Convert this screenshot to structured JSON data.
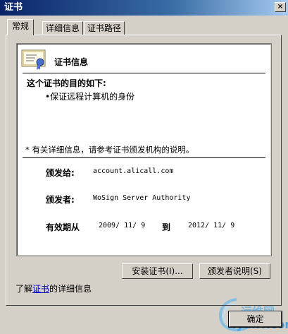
{
  "window": {
    "title": "证书",
    "close_label": "×"
  },
  "tabs": [
    {
      "label": "常规",
      "active": true
    },
    {
      "label": "详细信息",
      "active": false
    },
    {
      "label": "证书路径",
      "active": false
    }
  ],
  "cert": {
    "header": "证书信息",
    "purpose_heading": "这个证书的目的如下:",
    "purpose_items": [
      "•保证远程计算机的身份"
    ],
    "note": "* 有关详细信息，请参考证书颁发机构的说明。",
    "issued_to_label": "颁发给:",
    "issued_to_value": "account.alicall.com",
    "issued_by_label": "颁发者:",
    "issued_by_value": "WoSign Server Authority",
    "valid_label": "有效期从",
    "valid_from": "2009/ 11/ 9",
    "valid_to_word": "到",
    "valid_to": "2012/ 11/ 9"
  },
  "buttons": {
    "install": "安装证书(I)...",
    "issuer_statement": "颁发者说明(S)",
    "ok": "确定"
  },
  "footer": {
    "prefix": "了解",
    "link": "证书",
    "suffix": "的详细信息"
  },
  "watermark": {
    "line1": "运维网",
    "line2": "iyunv.com"
  }
}
